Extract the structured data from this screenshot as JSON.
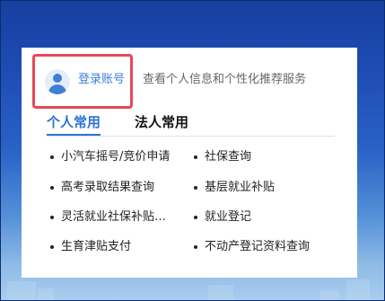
{
  "login": {
    "label": "登录账号",
    "description": "查看个人信息和个性化推荐服务"
  },
  "tabs": [
    {
      "label": "个人常用",
      "active": true
    },
    {
      "label": "法人常用",
      "active": false
    }
  ],
  "services": {
    "left": [
      "小汽车摇号/竞价申请",
      "高考录取结果查询",
      "灵活就业社保补贴…",
      "生育津贴支付"
    ],
    "right": [
      "社保查询",
      "基层就业补贴",
      "就业登记",
      "不动产登记资料查询"
    ]
  },
  "colors": {
    "accent": "#2f73cf",
    "highlight_border": "#e8475a",
    "text": "#222222",
    "muted_text": "#666666"
  }
}
